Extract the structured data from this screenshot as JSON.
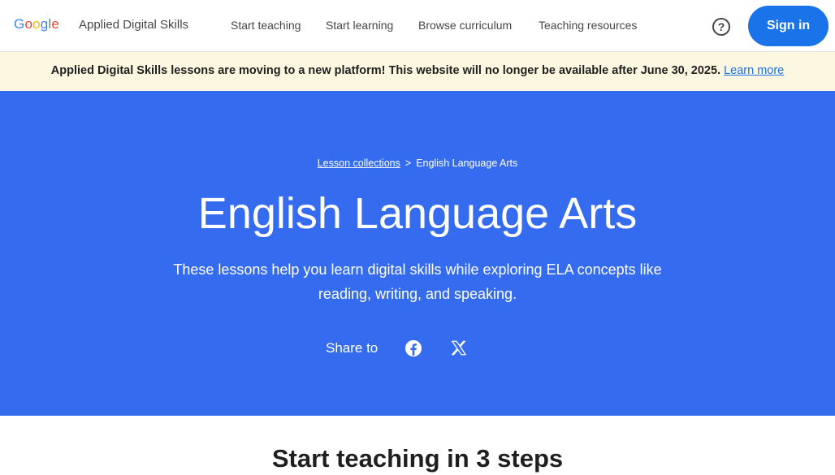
{
  "header": {
    "logo_letters": [
      {
        "ch": "G",
        "color": "#4285f4"
      },
      {
        "ch": "o",
        "color": "#ea4335"
      },
      {
        "ch": "o",
        "color": "#fbbc05"
      },
      {
        "ch": "g",
        "color": "#4285f4"
      },
      {
        "ch": "l",
        "color": "#34a853"
      },
      {
        "ch": "e",
        "color": "#ea4335"
      }
    ],
    "site_name": "Applied Digital Skills",
    "nav": {
      "start_teaching": "Start teaching",
      "start_learning": "Start learning",
      "browse_curriculum": "Browse curriculum",
      "teaching_resources": "Teaching resources"
    },
    "help_icon": "help-circle-icon",
    "help_glyph": "?",
    "signin_label": "Sign in"
  },
  "banner": {
    "message": "Applied Digital Skills lessons are moving to a new platform! This website will no longer be available after June 30, 2025.",
    "link_label": "Learn more"
  },
  "hero": {
    "breadcrumb": {
      "parent": "Lesson collections",
      "separator": ">",
      "current": "English Language Arts"
    },
    "title": "English Language Arts",
    "description": "These lessons help you learn digital skills while exploring ELA concepts like reading, writing, and speaking.",
    "share_label": "Share to",
    "share_icons": [
      "facebook-icon",
      "x-icon"
    ]
  },
  "section": {
    "heading": "Start teaching in 3 steps"
  },
  "colors": {
    "accent": "#1a73e8",
    "hero_bg": "#356bef",
    "banner_bg": "#fdf7e1"
  }
}
